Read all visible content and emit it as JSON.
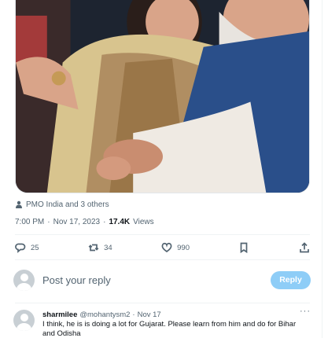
{
  "tweet": {
    "tagged_text": "PMO India and 3 others",
    "time": "7:00 PM",
    "date": "Nov 17, 2023",
    "views_count": "17.4K",
    "views_label": "Views"
  },
  "actions": {
    "replies": "25",
    "reposts": "34",
    "likes": "990"
  },
  "compose": {
    "placeholder": "Post your reply",
    "reply_button": "Reply"
  },
  "comment": {
    "name": "sharmilee",
    "handle": "@mohantysm2",
    "date": "Nov 17",
    "text": "I think, he is is doing a lot for Gujarat. Please learn from him and do for Bihar and Odisha"
  },
  "icons": {
    "reply": "reply-icon",
    "repost": "repost-icon",
    "like": "heart-icon",
    "bookmark": "bookmark-icon",
    "share": "share-icon",
    "more": "more-icon",
    "person": "person-icon"
  },
  "colors": {
    "reply_button": "#8ecdf7",
    "secondary_text": "#536471",
    "primary_text": "#0f1419"
  }
}
